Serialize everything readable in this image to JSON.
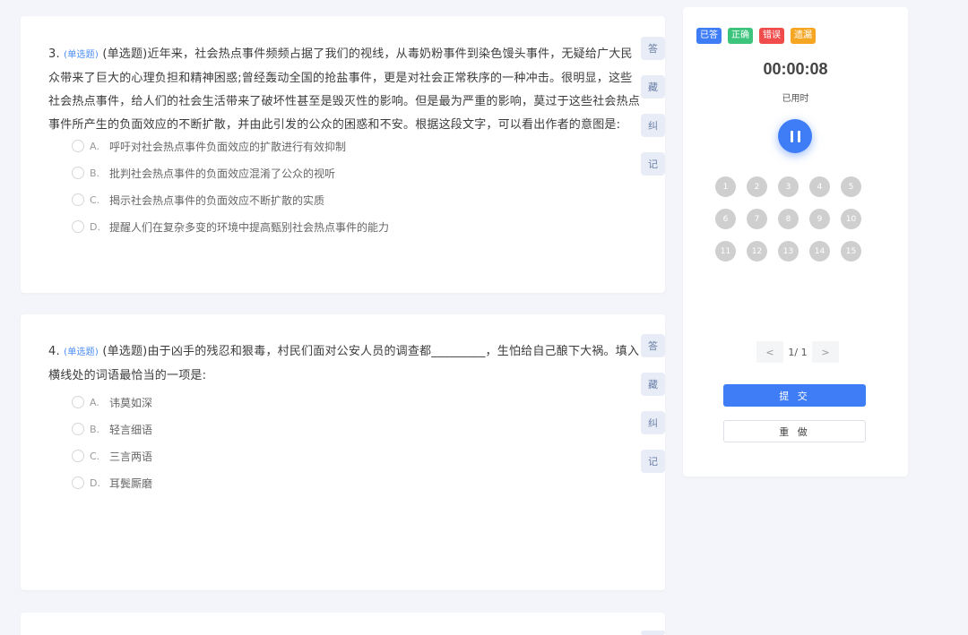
{
  "questions": [
    {
      "number": "3.",
      "type_tag": "(单选题)",
      "text": "(单选题)近年来，社会热点事件频频占据了我们的视线，从毒奶粉事件到染色馒头事件，无疑给广大民众带来了巨大的心理负担和精神困惑;曾经轰动全国的抢盐事件，更是对社会正常秩序的一种冲击。很明显，这些社会热点事件，给人们的社会生活带来了破坏性甚至是毁灭性的影响。但是最为严重的影响，莫过于这些社会热点事件所产生的负面效应的不断扩散，并由此引发的公众的困惑和不安。根据这段文字，可以看出作者的意图是:",
      "options": [
        {
          "key": "A.",
          "text": "呼吁对社会热点事件负面效应的扩散进行有效抑制"
        },
        {
          "key": "B.",
          "text": "批判社会热点事件的负面效应混淆了公众的视听"
        },
        {
          "key": "C.",
          "text": "揭示社会热点事件的负面效应不断扩散的实质"
        },
        {
          "key": "D.",
          "text": "提醒人们在复杂多变的环境中提高甄别社会热点事件的能力"
        }
      ],
      "tools": [
        "答",
        "藏",
        "纠",
        "记"
      ]
    },
    {
      "number": "4.",
      "type_tag": "(单选题)",
      "text": "(单选题)由于凶手的残忍和狠毒，村民们面对公安人员的调查都_________，生怕给自己酿下大祸。填入横线处的词语最恰当的一项是:",
      "options": [
        {
          "key": "A.",
          "text": "讳莫如深"
        },
        {
          "key": "B.",
          "text": "轻言细语"
        },
        {
          "key": "C.",
          "text": "三言两语"
        },
        {
          "key": "D.",
          "text": "耳鬓厮磨"
        }
      ],
      "tools": [
        "答",
        "藏",
        "纠",
        "记"
      ]
    }
  ],
  "panel": {
    "legend": [
      {
        "label": "已答",
        "color": "#3e7df5"
      },
      {
        "label": "正确",
        "color": "#3cc47c"
      },
      {
        "label": "错误",
        "color": "#f04c4c"
      },
      {
        "label": "遗漏",
        "color": "#f5a623"
      }
    ],
    "timer": "00:00:08",
    "timer_label": "已用时",
    "numbers": [
      "1",
      "2",
      "3",
      "4",
      "5",
      "6",
      "7",
      "8",
      "9",
      "10",
      "11",
      "12",
      "13",
      "14",
      "15"
    ],
    "pager": {
      "prev": "<",
      "text": "1/ 1",
      "next": ">"
    },
    "submit_label": "提 交",
    "redo_label": "重 做"
  }
}
